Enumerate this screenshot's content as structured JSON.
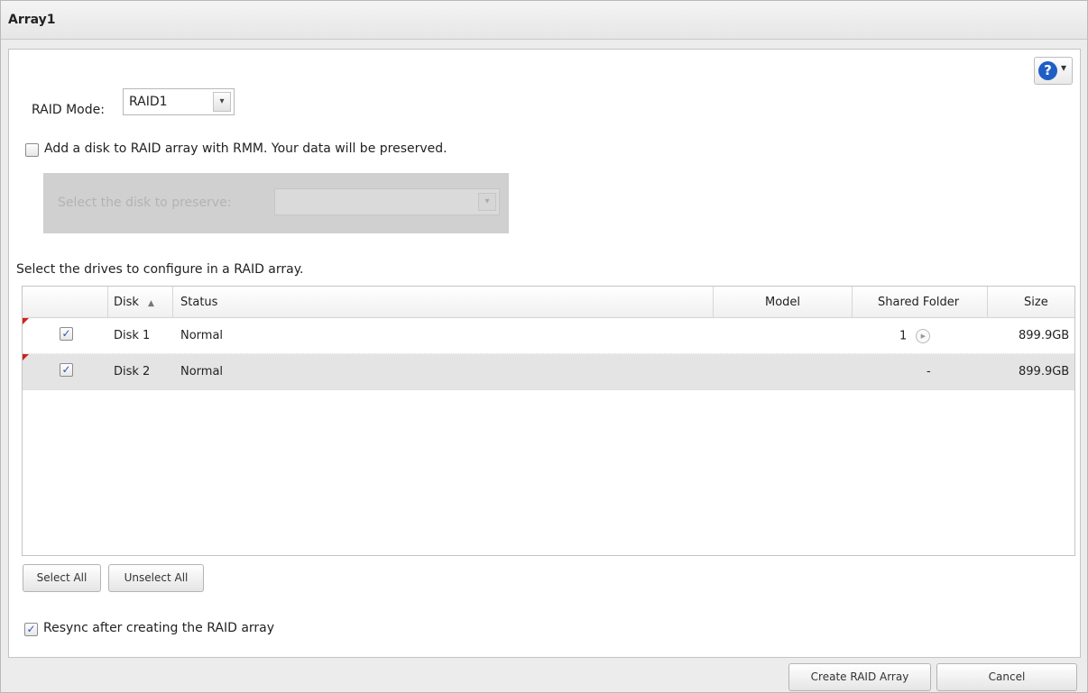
{
  "window": {
    "title": "Array1"
  },
  "help": {
    "icon": "help-icon",
    "glyph": "?",
    "caret": "▾"
  },
  "raid_mode": {
    "label": "RAID Mode:",
    "value": "RAID1",
    "arrow": "▾"
  },
  "rmm": {
    "checked": false,
    "label": "Add a disk to RAID array with RMM. Your data will be preserved.",
    "preserve_label": "Select the disk to preserve:",
    "preserve_value": ""
  },
  "drives": {
    "label": "Select the drives to configure in a RAID array.",
    "columns": {
      "disk": "Disk",
      "status": "Status",
      "model": "Model",
      "shared_folder": "Shared Folder",
      "size": "Size"
    },
    "sort_indicator": "▲",
    "rows": [
      {
        "checked": true,
        "disk": "Disk 1",
        "status": "Normal",
        "model": "",
        "shared_folder": "1",
        "size": "899.9GB"
      },
      {
        "checked": true,
        "disk": "Disk 2",
        "status": "Normal",
        "model": "",
        "shared_folder": "-",
        "size": "899.9GB"
      }
    ]
  },
  "buttons": {
    "select_all": "Select All",
    "unselect_all": "Unselect All",
    "create": "Create RAID Array",
    "cancel": "Cancel"
  },
  "resync": {
    "checked": true,
    "label": "Resync after creating the RAID array"
  },
  "check_glyph": "✓",
  "colors": {
    "help_blue": "#1d5fc4",
    "modified_marker": "#d21f1f",
    "row_selected": "#e4e4e4"
  }
}
